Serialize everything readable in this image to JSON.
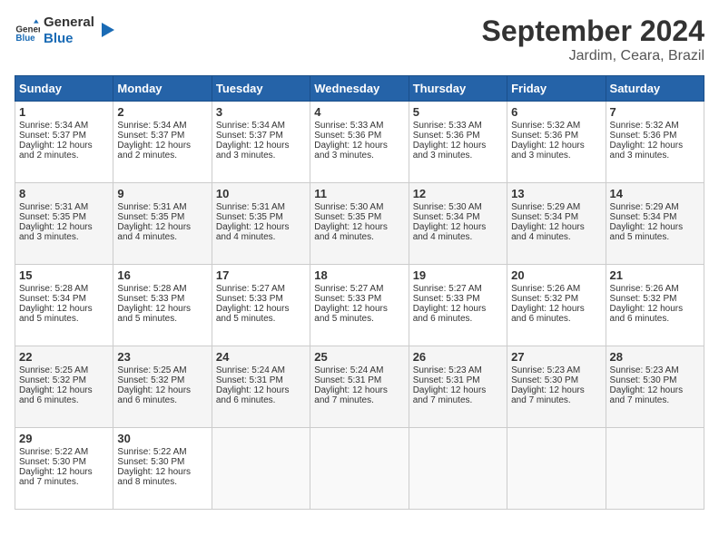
{
  "logo": {
    "text_general": "General",
    "text_blue": "Blue"
  },
  "header": {
    "month": "September 2024",
    "location": "Jardim, Ceara, Brazil"
  },
  "days_of_week": [
    "Sunday",
    "Monday",
    "Tuesday",
    "Wednesday",
    "Thursday",
    "Friday",
    "Saturday"
  ],
  "weeks": [
    [
      {
        "day": "1",
        "sun": "5:34 AM",
        "set": "5:37 PM",
        "dl": "12 hours and 2 minutes."
      },
      {
        "day": "2",
        "sun": "5:34 AM",
        "set": "5:37 PM",
        "dl": "12 hours and 2 minutes."
      },
      {
        "day": "3",
        "sun": "5:34 AM",
        "set": "5:37 PM",
        "dl": "12 hours and 3 minutes."
      },
      {
        "day": "4",
        "sun": "5:33 AM",
        "set": "5:36 PM",
        "dl": "12 hours and 3 minutes."
      },
      {
        "day": "5",
        "sun": "5:33 AM",
        "set": "5:36 PM",
        "dl": "12 hours and 3 minutes."
      },
      {
        "day": "6",
        "sun": "5:32 AM",
        "set": "5:36 PM",
        "dl": "12 hours and 3 minutes."
      },
      {
        "day": "7",
        "sun": "5:32 AM",
        "set": "5:36 PM",
        "dl": "12 hours and 3 minutes."
      }
    ],
    [
      {
        "day": "8",
        "sun": "5:31 AM",
        "set": "5:35 PM",
        "dl": "12 hours and 3 minutes."
      },
      {
        "day": "9",
        "sun": "5:31 AM",
        "set": "5:35 PM",
        "dl": "12 hours and 4 minutes."
      },
      {
        "day": "10",
        "sun": "5:31 AM",
        "set": "5:35 PM",
        "dl": "12 hours and 4 minutes."
      },
      {
        "day": "11",
        "sun": "5:30 AM",
        "set": "5:35 PM",
        "dl": "12 hours and 4 minutes."
      },
      {
        "day": "12",
        "sun": "5:30 AM",
        "set": "5:34 PM",
        "dl": "12 hours and 4 minutes."
      },
      {
        "day": "13",
        "sun": "5:29 AM",
        "set": "5:34 PM",
        "dl": "12 hours and 4 minutes."
      },
      {
        "day": "14",
        "sun": "5:29 AM",
        "set": "5:34 PM",
        "dl": "12 hours and 5 minutes."
      }
    ],
    [
      {
        "day": "15",
        "sun": "5:28 AM",
        "set": "5:34 PM",
        "dl": "12 hours and 5 minutes."
      },
      {
        "day": "16",
        "sun": "5:28 AM",
        "set": "5:33 PM",
        "dl": "12 hours and 5 minutes."
      },
      {
        "day": "17",
        "sun": "5:27 AM",
        "set": "5:33 PM",
        "dl": "12 hours and 5 minutes."
      },
      {
        "day": "18",
        "sun": "5:27 AM",
        "set": "5:33 PM",
        "dl": "12 hours and 5 minutes."
      },
      {
        "day": "19",
        "sun": "5:27 AM",
        "set": "5:33 PM",
        "dl": "12 hours and 6 minutes."
      },
      {
        "day": "20",
        "sun": "5:26 AM",
        "set": "5:32 PM",
        "dl": "12 hours and 6 minutes."
      },
      {
        "day": "21",
        "sun": "5:26 AM",
        "set": "5:32 PM",
        "dl": "12 hours and 6 minutes."
      }
    ],
    [
      {
        "day": "22",
        "sun": "5:25 AM",
        "set": "5:32 PM",
        "dl": "12 hours and 6 minutes."
      },
      {
        "day": "23",
        "sun": "5:25 AM",
        "set": "5:32 PM",
        "dl": "12 hours and 6 minutes."
      },
      {
        "day": "24",
        "sun": "5:24 AM",
        "set": "5:31 PM",
        "dl": "12 hours and 6 minutes."
      },
      {
        "day": "25",
        "sun": "5:24 AM",
        "set": "5:31 PM",
        "dl": "12 hours and 7 minutes."
      },
      {
        "day": "26",
        "sun": "5:23 AM",
        "set": "5:31 PM",
        "dl": "12 hours and 7 minutes."
      },
      {
        "day": "27",
        "sun": "5:23 AM",
        "set": "5:30 PM",
        "dl": "12 hours and 7 minutes."
      },
      {
        "day": "28",
        "sun": "5:23 AM",
        "set": "5:30 PM",
        "dl": "12 hours and 7 minutes."
      }
    ],
    [
      {
        "day": "29",
        "sun": "5:22 AM",
        "set": "5:30 PM",
        "dl": "12 hours and 7 minutes."
      },
      {
        "day": "30",
        "sun": "5:22 AM",
        "set": "5:30 PM",
        "dl": "12 hours and 8 minutes."
      },
      null,
      null,
      null,
      null,
      null
    ]
  ],
  "labels": {
    "sunrise": "Sunrise:",
    "sunset": "Sunset:",
    "daylight": "Daylight:"
  }
}
